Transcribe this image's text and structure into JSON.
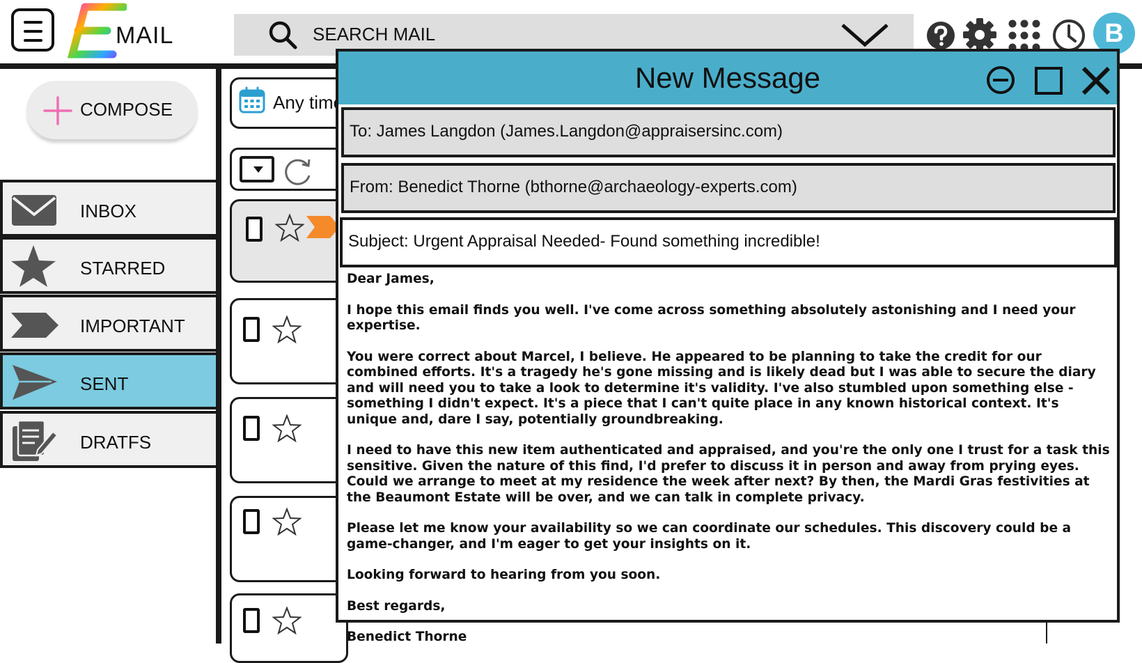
{
  "app": {
    "logo_letter": "E",
    "logo_text": "MAIL",
    "avatar_initial": "B"
  },
  "search": {
    "label": "SEARCH MAIL"
  },
  "sidebar": {
    "compose_label": "COMPOSE",
    "items": [
      {
        "label": "INBOX"
      },
      {
        "label": "STARRED"
      },
      {
        "label": "IMPORTANT"
      },
      {
        "label": "SENT",
        "active": true
      },
      {
        "label": "DRATFS"
      }
    ]
  },
  "list": {
    "filter_label": "Any time"
  },
  "compose": {
    "title": "New Message",
    "to": "To: James Langdon (James.Langdon@appraisersinc.com)",
    "from": "From: Benedict Thorne (bthorne@archaeology-experts.com)",
    "subject": "Subject: Urgent Appraisal Needed- Found something incredible!",
    "body": [
      "Dear James,",
      "I hope this email finds you well. I've come across something absolutely astonishing and I need your expertise.",
      "You were correct about Marcel, I believe. He appeared to be planning to take the credit for our combined efforts. It's a tragedy he's gone missing and is likely dead but I was able to secure the diary and will need you to take a look to determine it's validity. I've also stumbled upon something else - something I didn't expect. It's a piece that I can't quite place in any known historical context. It's unique and, dare I say, potentially groundbreaking.",
      "I need to have this new item authenticated and appraised, and you're the only one I trust for a task this sensitive. Given the nature of this find, I'd prefer to discuss it in person and away from prying eyes. Could we arrange to meet at my residence the week after next? By then, the Mardi Gras festivities at the Beaumont Estate will be over, and we can talk in complete privacy.",
      "Please let me know your availability so we can coordinate our schedules. This discovery could be a game-changer, and I'm eager to get your insights on it.",
      "Looking forward to hearing from you soon.",
      "Best regards,",
      "Benedict Thorne"
    ]
  },
  "colors": {
    "accent": "#4aaecb",
    "sent_active": "#7ccbe0",
    "avatar": "#4fb8d6",
    "important_arrow": "#f58a2b",
    "compose_plus": "#f06fb4"
  },
  "icons": [
    "menu-icon",
    "search-icon",
    "chevron-down-icon",
    "help-icon",
    "gear-icon",
    "apps-icon",
    "clock-icon",
    "plus-icon",
    "envelope-icon",
    "star-icon",
    "label-arrow-icon",
    "send-icon",
    "drafts-icon",
    "calendar-icon",
    "refresh-icon",
    "minimize-icon",
    "maximize-icon",
    "close-icon"
  ]
}
